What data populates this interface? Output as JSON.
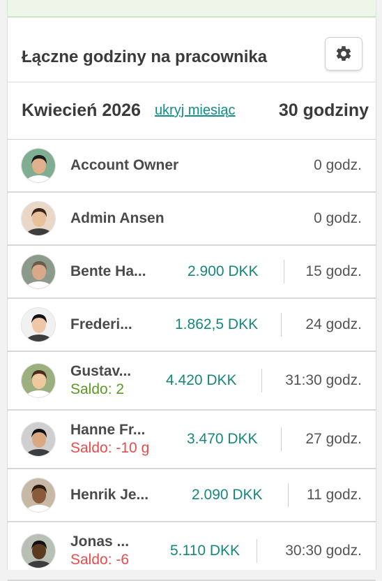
{
  "panel": {
    "title": "Łączne godziny na pracownika",
    "settings_icon": "gear-icon"
  },
  "month": {
    "name": "Kwiecień 2026",
    "toggle_label": "ukryj miesiąc",
    "total": "30 godziny"
  },
  "employees": [
    {
      "name": "Account Owner",
      "amount": "",
      "balance": "",
      "hours": "0 godz.",
      "avatar_bg": "#7fae93"
    },
    {
      "name": "Admin Ansen",
      "amount": "",
      "balance": "",
      "hours": "0 godz.",
      "avatar_bg": "#e9d8c8"
    },
    {
      "name": "Bente Ha...",
      "amount": "2.900 DKK",
      "balance": "",
      "hours": "15 godz.",
      "avatar_bg": "#8b9a8a"
    },
    {
      "name": "Frederi...",
      "amount": "1.862,5 DKK",
      "balance": "",
      "hours": "24 godz.",
      "avatar_bg": "#f1f1f1"
    },
    {
      "name": "Gustav...",
      "amount": "4.420 DKK",
      "balance": "Saldo: 2",
      "hours": "31:30 godz.",
      "avatar_bg": "#9bb07e"
    },
    {
      "name": "Hanne Fr...",
      "amount": "3.470 DKK",
      "balance": "Saldo: -10 g",
      "hours": "27 godz.",
      "avatar_bg": "#cfcfcf"
    },
    {
      "name": "Henrik Je...",
      "amount": "2.090 DKK",
      "balance": "",
      "hours": "11 godz.",
      "avatar_bg": "#c8b8a6"
    },
    {
      "name": "Jonas ...",
      "amount": "5.110 DKK",
      "balance": "Saldo: -6",
      "hours": "30:30 godz.",
      "avatar_bg": "#b8c0b5"
    }
  ],
  "colors": {
    "accent_teal": "#17877c",
    "link_teal": "#0f8f86",
    "positive_green": "#5a9a23",
    "negative_red": "#e84c4c"
  }
}
